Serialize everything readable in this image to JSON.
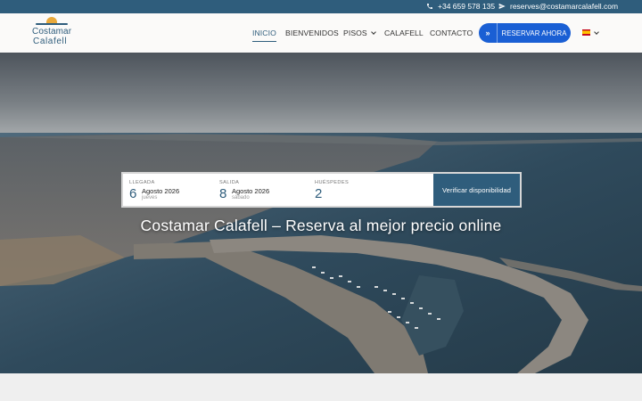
{
  "topbar": {
    "phone": "+34 659 578 135",
    "email": "reserves@costamarcalafell.com"
  },
  "logo": {
    "line1": "Costamar",
    "line2": "Calafell"
  },
  "nav": {
    "items": [
      {
        "label": "INICIO",
        "active": true
      },
      {
        "label": "BIENVENIDOS"
      },
      {
        "label": "PISOS",
        "has_dropdown": true
      },
      {
        "label": "CALAFELL"
      },
      {
        "label": "CONTACTO"
      }
    ],
    "reserve_label": "RESERVAR AHORA",
    "reserve_icon": "»",
    "language_icon": "spain-flag-icon"
  },
  "booking": {
    "arrival": {
      "label": "LLEGADA",
      "day": "6",
      "month": "Agosto 2026",
      "weekday": "jueves"
    },
    "departure": {
      "label": "SALIDA",
      "day": "8",
      "month": "Agosto 2026",
      "weekday": "sábado"
    },
    "guests": {
      "label": "HUÉSPEDES",
      "count": "2"
    },
    "verify_label": "Verificar disponibilidad"
  },
  "hero": {
    "title": "Costamar Calafell – Reserva al mejor precio online"
  },
  "colors": {
    "topbar": "#2f5d7c",
    "accent_button": "#1a5fd4",
    "brand": "#2f5d7c",
    "sun": "#e9a93b"
  }
}
